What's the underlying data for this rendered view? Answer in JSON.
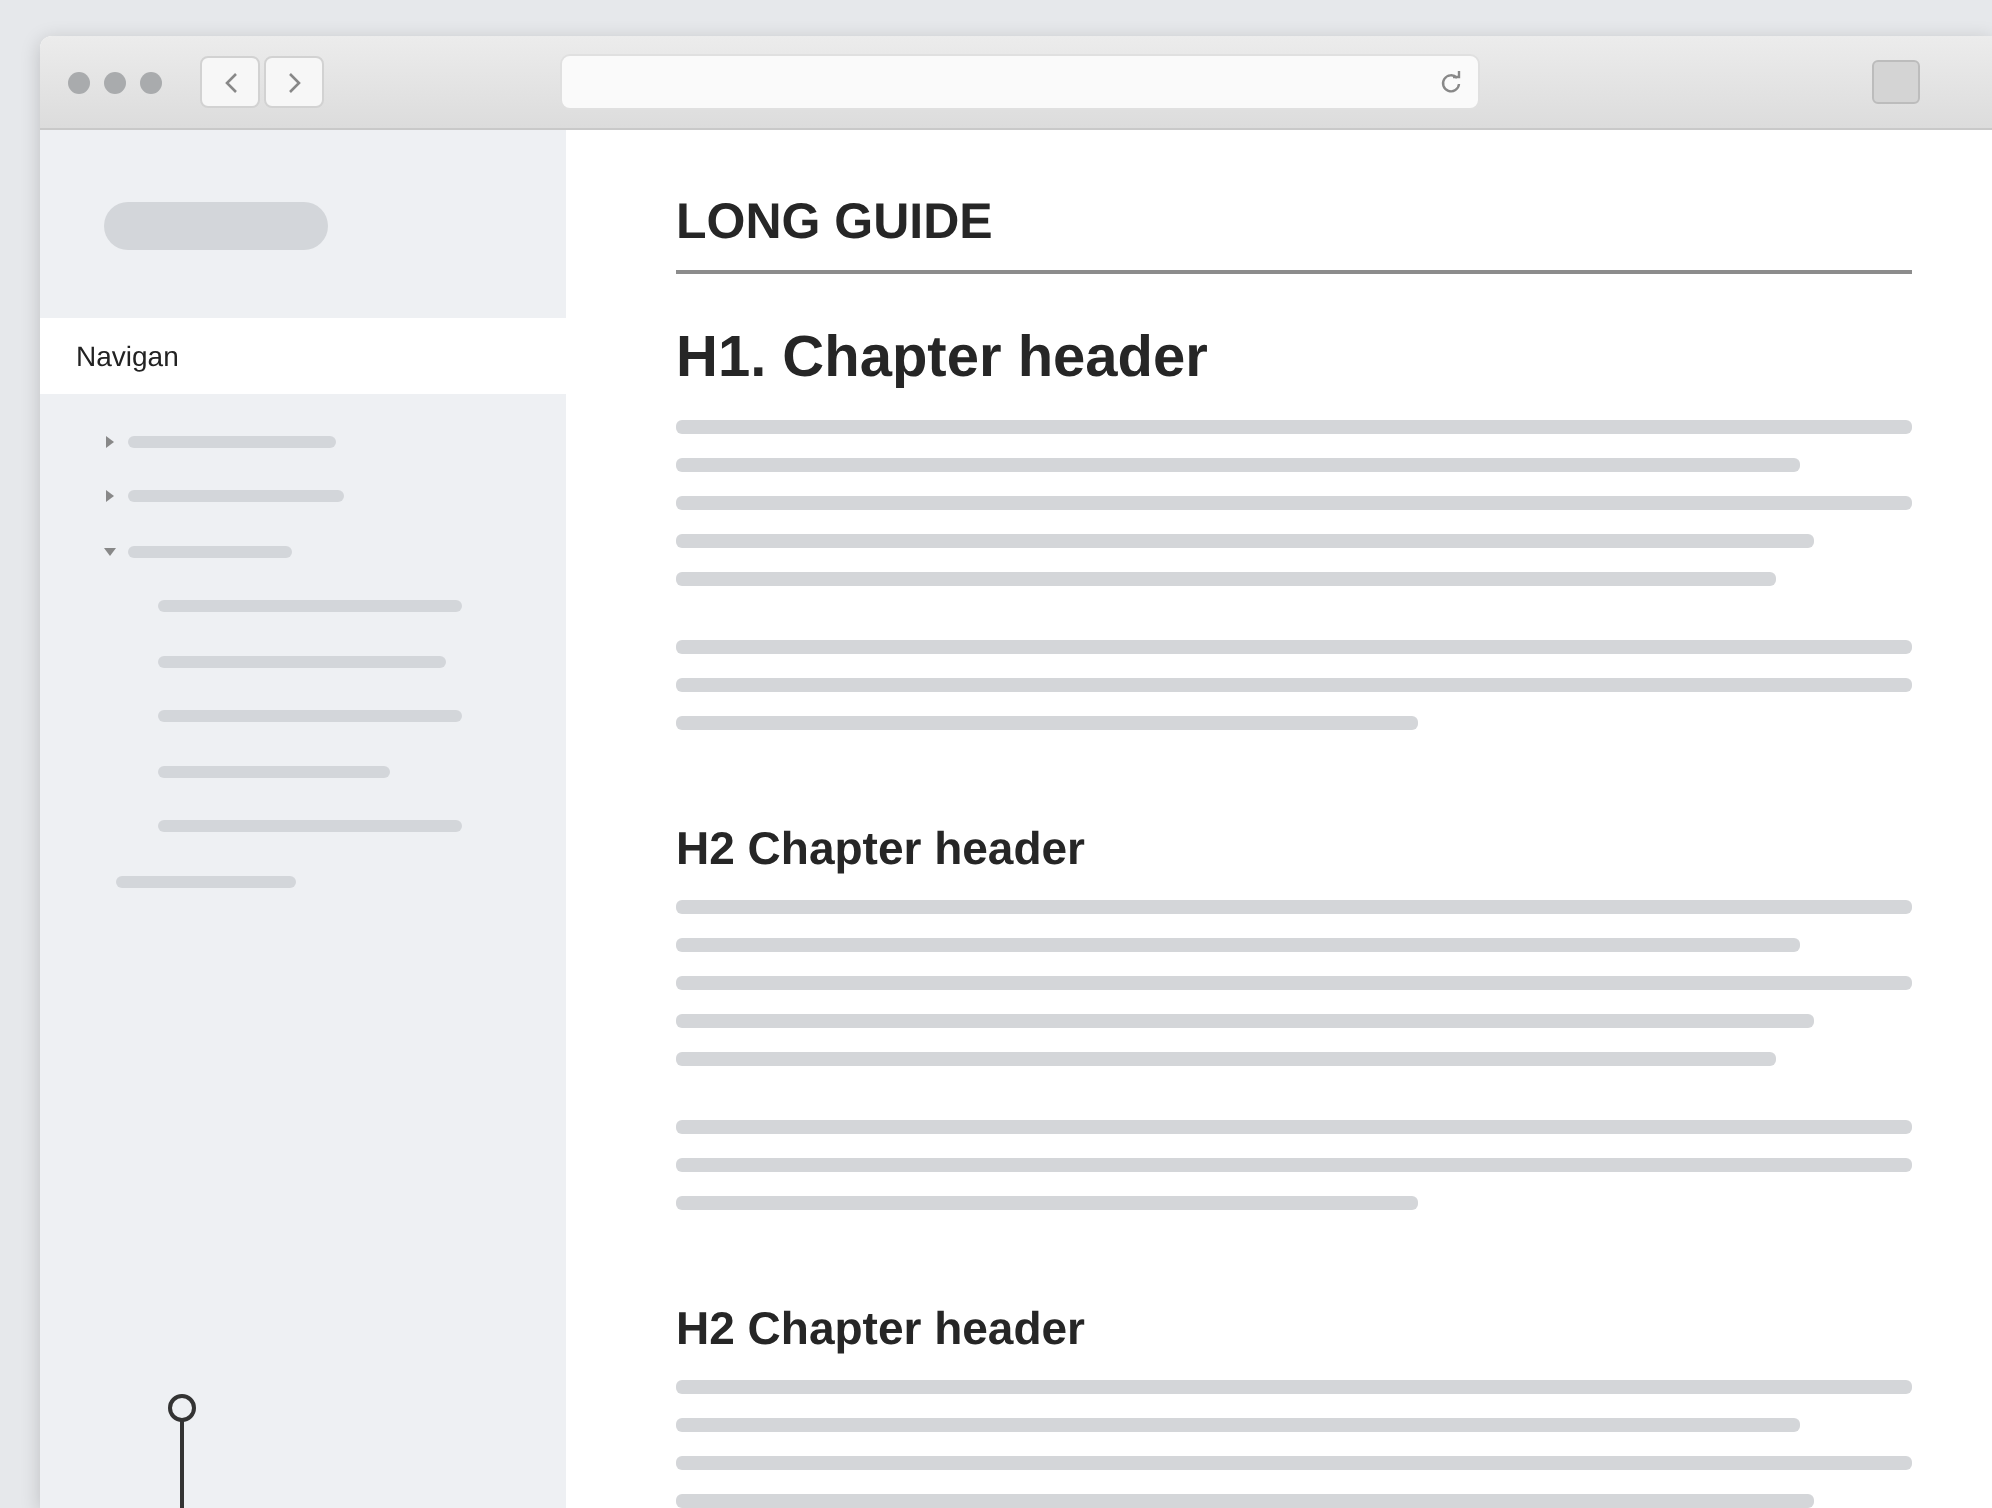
{
  "sidebar": {
    "header": {
      "label": "Navigan",
      "selected": true
    },
    "items": [
      {
        "kind": "group",
        "expanded": false,
        "selected": false
      },
      {
        "kind": "group",
        "expanded": false,
        "selected": false
      },
      {
        "kind": "group",
        "expanded": true,
        "selected": false,
        "children": [
          {
            "selected": false
          },
          {
            "selected": false
          },
          {
            "selected": false
          },
          {
            "selected": false
          },
          {
            "selected": false
          }
        ]
      },
      {
        "kind": "link",
        "selected": false
      }
    ]
  },
  "content": {
    "title": "LONG GUIDE",
    "sections": [
      {
        "kind": "h1",
        "heading": "H1. Chapter header"
      },
      {
        "kind": "h2",
        "heading": "H2 Chapter header"
      },
      {
        "kind": "h2",
        "heading": "H2 Chapter header"
      }
    ]
  }
}
